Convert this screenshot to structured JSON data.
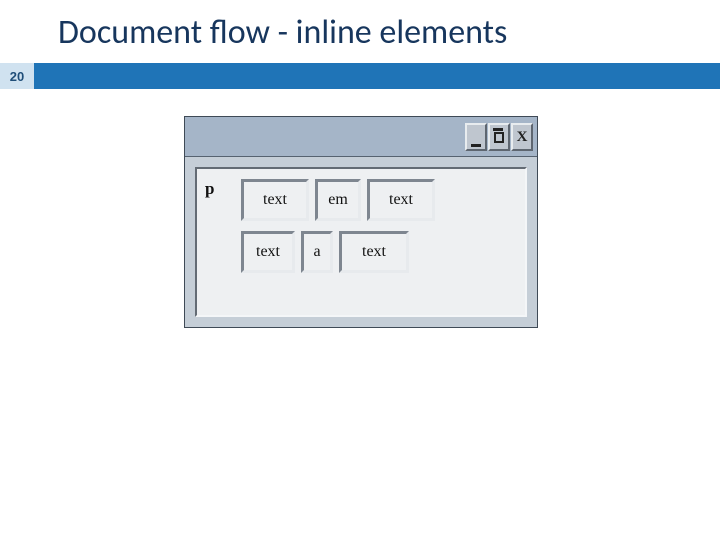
{
  "slide": {
    "title": "Document flow - inline elements",
    "page_number": "20"
  },
  "window": {
    "buttons": {
      "minimize": "_",
      "restore": "▢",
      "close": "X"
    }
  },
  "diagram": {
    "p_label": "p",
    "row1": [
      {
        "label": "text"
      },
      {
        "label": "em"
      },
      {
        "label": "text"
      }
    ],
    "row2": [
      {
        "label": "text"
      },
      {
        "label": "a"
      },
      {
        "label": "text"
      }
    ]
  }
}
